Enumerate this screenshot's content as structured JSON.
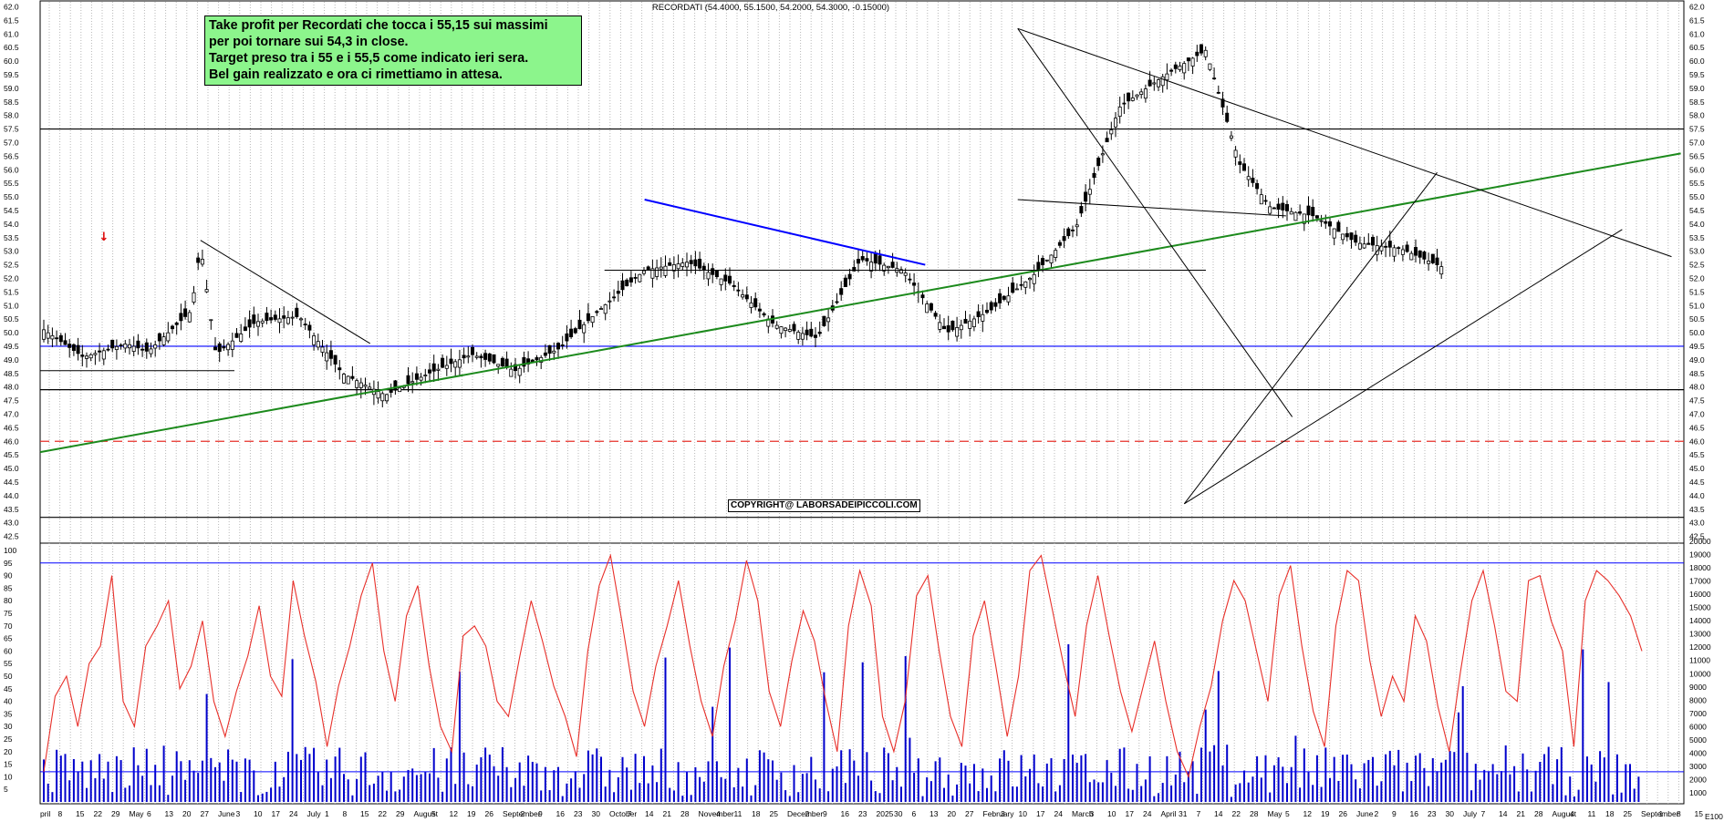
{
  "chart_data": [
    {
      "type": "candlestick",
      "title": "RECORDATI (54.4000, 55.1500, 54.2000, 54.3000, -0.15000)",
      "ylim": [
        42.25,
        62.25
      ],
      "y_ticks": [
        "42.5",
        "43.0",
        "43.5",
        "44.0",
        "44.5",
        "45.0",
        "45.5",
        "46.0",
        "46.5",
        "47.0",
        "47.5",
        "48.0",
        "48.5",
        "49.0",
        "49.5",
        "50.0",
        "50.5",
        "51.0",
        "51.5",
        "52.0",
        "52.5",
        "53.0",
        "53.5",
        "54.0",
        "54.5",
        "55.0",
        "55.5",
        "56.0",
        "56.5",
        "57.0",
        "57.5",
        "58.0",
        "58.5",
        "59.0",
        "59.5",
        "60.0",
        "60.5",
        "61.0",
        "61.5",
        "62.0"
      ],
      "grid": "vertical dotted lines at each week",
      "horizontal_levels": [
        {
          "price": 57.5,
          "color": "#000000",
          "style": "solid"
        },
        {
          "price": 49.5,
          "color": "#0000ff",
          "style": "solid"
        },
        {
          "price": 47.9,
          "color": "#000000",
          "style": "solid"
        },
        {
          "price": 46.0,
          "color": "#e8302a",
          "style": "dashed"
        },
        {
          "price": 43.2,
          "color": "#000000",
          "style": "solid"
        }
      ],
      "trendlines": [
        {
          "from": [
            "2024-04-01",
            45.6
          ],
          "to": [
            "2025-09-15",
            56.6
          ],
          "color": "#1c8a1c",
          "width": 2
        },
        {
          "from": [
            "2024-05-23",
            53.4
          ],
          "to": [
            "2024-07-17",
            49.6
          ],
          "color": "#000000",
          "width": 1
        },
        {
          "from": [
            "2024-10-14",
            54.9
          ],
          "to": [
            "2025-01-13",
            52.5
          ],
          "color": "#0000ff",
          "width": 2
        },
        {
          "from": [
            "2025-02-12",
            61.2
          ],
          "to": [
            "2025-05-12",
            46.9
          ],
          "color": "#000000",
          "width": 1
        },
        {
          "from": [
            "2025-02-12",
            61.2
          ],
          "to": [
            "2025-09-12",
            52.8
          ],
          "color": "#000000",
          "width": 1
        },
        {
          "from": [
            "2025-04-07",
            43.7
          ],
          "to": [
            "2025-06-28",
            55.9
          ],
          "color": "#000000",
          "width": 1
        },
        {
          "from": [
            "2025-04-07",
            43.7
          ],
          "to": [
            "2025-08-27",
            53.8
          ],
          "color": "#000000",
          "width": 1
        },
        {
          "from": [
            "2025-02-12",
            54.9
          ],
          "to": [
            "2025-05-10",
            54.3
          ],
          "color": "#000000",
          "width": 1
        },
        {
          "from": [
            "2024-10-01",
            52.3
          ],
          "to": [
            "2025-04-14",
            52.3
          ],
          "color": "#000000",
          "width": 1
        },
        {
          "from": [
            "2024-04-01",
            48.6
          ],
          "to": [
            "2024-06-03",
            48.6
          ],
          "color": "#000000",
          "width": 1
        }
      ],
      "signal_marker": {
        "date": "2024-05-23",
        "label": "↓",
        "color": "#dd0000"
      },
      "price_path": [
        [
          "2024-04-01",
          50.2
        ],
        [
          "2024-04-15",
          49.1
        ],
        [
          "2024-04-29",
          49.6
        ],
        [
          "2024-05-06",
          49.3
        ],
        [
          "2024-05-20",
          50.8
        ],
        [
          "2024-05-23",
          53.2
        ],
        [
          "2024-05-28",
          49.2
        ],
        [
          "2024-06-10",
          50.4
        ],
        [
          "2024-06-24",
          50.6
        ],
        [
          "2024-07-08",
          48.5
        ],
        [
          "2024-07-22",
          47.7
        ],
        [
          "2024-08-05",
          48.5
        ],
        [
          "2024-08-19",
          49.2
        ],
        [
          "2024-09-02",
          48.6
        ],
        [
          "2024-09-16",
          49.4
        ],
        [
          "2024-09-30",
          50.9
        ],
        [
          "2024-10-14",
          52.3
        ],
        [
          "2024-10-28",
          52.6
        ],
        [
          "2024-11-11",
          51.8
        ],
        [
          "2024-11-25",
          50.3
        ],
        [
          "2024-12-09",
          49.8
        ],
        [
          "2024-12-23",
          52.7
        ],
        [
          "2025-01-06",
          52.3
        ],
        [
          "2025-01-20",
          50.0
        ],
        [
          "2025-02-03",
          50.8
        ],
        [
          "2025-02-17",
          52.1
        ],
        [
          "2025-03-03",
          53.9
        ],
        [
          "2025-03-17",
          58.3
        ],
        [
          "2025-04-01",
          59.5
        ],
        [
          "2025-04-14",
          60.4
        ],
        [
          "2025-04-25",
          56.2
        ],
        [
          "2025-05-05",
          54.6
        ],
        [
          "2025-05-19",
          54.3
        ],
        [
          "2025-06-02",
          53.3
        ],
        [
          "2025-06-16",
          53.1
        ],
        [
          "2025-06-30",
          52.4
        ]
      ]
    },
    {
      "type": "indicator",
      "series": [
        {
          "name": "",
          "kind": "line",
          "color": "#e8302a",
          "scale": "0-100"
        },
        {
          "name": "",
          "kind": "bar",
          "color": "#0000cc",
          "scale": "volume"
        }
      ],
      "ylim_left": [
        0,
        100
      ],
      "ylim_right": [
        1000,
        20000
      ],
      "left_ticks": [
        "5",
        "10",
        "15",
        "20",
        "25",
        "30",
        "35",
        "40",
        "45",
        "50",
        "55",
        "60",
        "65",
        "70",
        "75",
        "80",
        "85",
        "90",
        "95",
        "100"
      ],
      "right_ticks": [
        "1000",
        "2000",
        "3000",
        "4000",
        "5000",
        "6000",
        "7000",
        "8000",
        "9000",
        "10000",
        "11000",
        "12000",
        "13000",
        "14000",
        "15000",
        "16000",
        "17000",
        "18000",
        "19000",
        "20000"
      ],
      "levels": [
        {
          "value": 95,
          "color": "#0000ff"
        },
        {
          "value": 12,
          "color": "#0000ff"
        }
      ],
      "oscillator_values": [
        12,
        42,
        50,
        30,
        55,
        62,
        90,
        40,
        30,
        62,
        70,
        80,
        45,
        54,
        72,
        40,
        26,
        44,
        58,
        78,
        50,
        42,
        88,
        66,
        48,
        22,
        46,
        62,
        82,
        95,
        60,
        40,
        74,
        86,
        54,
        30,
        20,
        66,
        70,
        62,
        40,
        34,
        58,
        80,
        64,
        46,
        34,
        18,
        60,
        86,
        98,
        72,
        44,
        30,
        54,
        70,
        88,
        62,
        40,
        26,
        54,
        72,
        96,
        80,
        44,
        30,
        56,
        76,
        64,
        40,
        20,
        70,
        92,
        78,
        34,
        20,
        40,
        82,
        90,
        60,
        34,
        22,
        66,
        80,
        54,
        26,
        50,
        92,
        98,
        76,
        54,
        34,
        70,
        90,
        66,
        44,
        28,
        46,
        64,
        40,
        20,
        10,
        30,
        46,
        72,
        88,
        80,
        60,
        40,
        82,
        94,
        62,
        36,
        22,
        70,
        92,
        88,
        56,
        34,
        50,
        40,
        74,
        64,
        38,
        20,
        52,
        80,
        92,
        70,
        44,
        40,
        88,
        90,
        72,
        60,
        22,
        80,
        92,
        88,
        82,
        74,
        60
      ]
    }
  ],
  "x_axis_labels": [
    "pril",
    "8",
    "15",
    "22",
    "29",
    "May",
    "6",
    "13",
    "20",
    "27",
    "June",
    "3",
    "10",
    "17",
    "24",
    "July",
    "1",
    "8",
    "15",
    "22",
    "29",
    "August",
    "5",
    "12",
    "19",
    "26",
    "September",
    "2",
    "9",
    "16",
    "23",
    "30",
    "October",
    "7",
    "14",
    "21",
    "28",
    "November",
    "4",
    "11",
    "18",
    "25",
    "December",
    "2",
    "9",
    "16",
    "23",
    "2025",
    "30",
    "6",
    "13",
    "20",
    "27",
    "February",
    "3",
    "10",
    "17",
    "24",
    "March",
    "3",
    "10",
    "17",
    "24",
    "April",
    "31",
    "7",
    "14",
    "22",
    "28",
    "May",
    "5",
    "12",
    "19",
    "26",
    "June",
    "2",
    "9",
    "16",
    "23",
    "30",
    "July",
    "7",
    "14",
    "21",
    "28",
    "August",
    "4",
    "11",
    "18",
    "25",
    "September",
    "1",
    "8",
    "15"
  ],
  "annotation": {
    "lines": [
      "Take profit per Recordati che tocca i 55,15 sui massimi",
      "per poi tornare sui 54,3 in close.",
      "Target preso tra i 55 e i 55,5 come indicato ieri sera.",
      "Bel gain realizzato e ora ci rimettiamo in attesa."
    ],
    "background": "#8cf58c"
  },
  "copyright": "COPYRIGHT@ LABORSADEIPICCOLI.COM",
  "corner_label": "E100"
}
